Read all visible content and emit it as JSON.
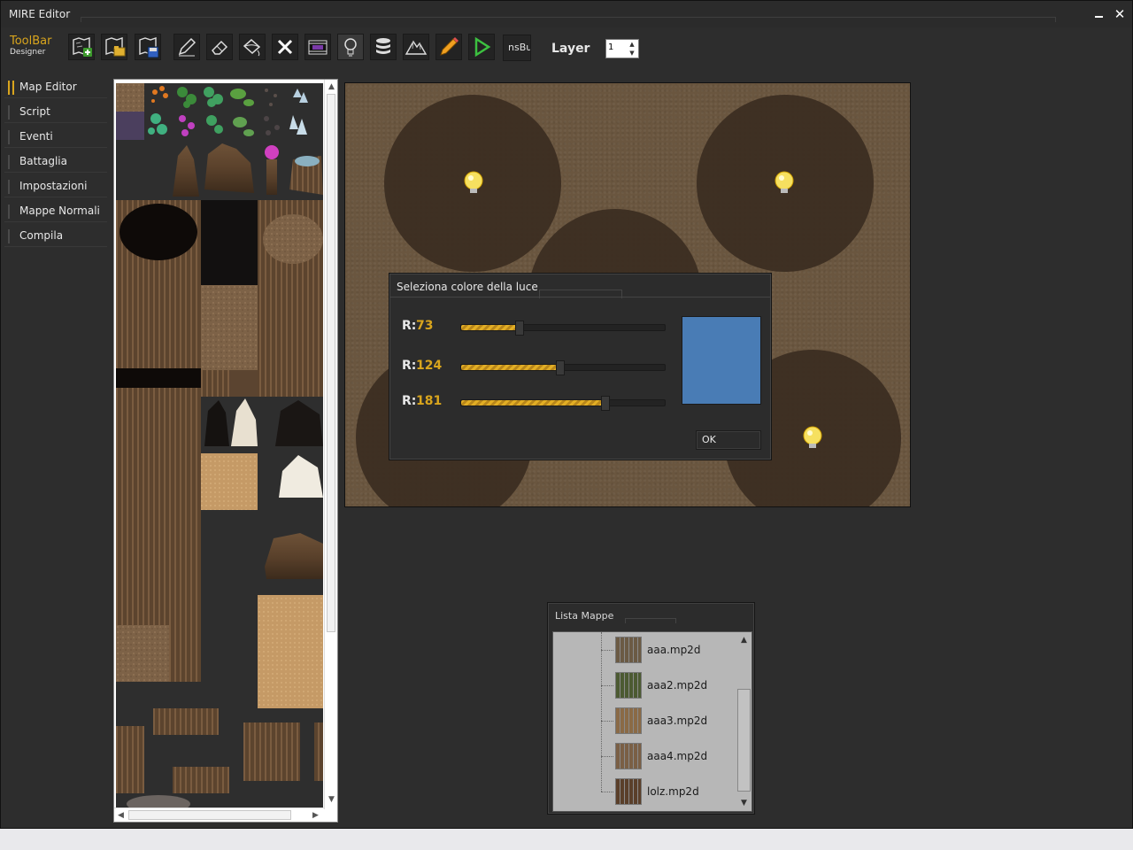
{
  "window": {
    "title": "MIRE Editor"
  },
  "toolbar": {
    "brand_main": "ToolBar",
    "brand_sub": "Designer",
    "tools": [
      "new-map-icon",
      "open-map-icon",
      "save-map-icon",
      "pencil-icon",
      "eraser-icon",
      "fill-bucket-icon",
      "delete-icon",
      "film-icon",
      "light-bulb-icon",
      "database-icon",
      "mountain-icon",
      "draw-icon",
      "play-icon"
    ],
    "nsbu_label": "nsBu",
    "layer_label": "Layer",
    "layer_value": "1"
  },
  "sidebar": {
    "items": [
      {
        "label": "Map Editor",
        "active": true
      },
      {
        "label": "Script"
      },
      {
        "label": "Eventi"
      },
      {
        "label": "Battaglia"
      },
      {
        "label": "Impostazioni"
      },
      {
        "label": "Mappe Normali"
      },
      {
        "label": "Compila"
      }
    ]
  },
  "dialog": {
    "title": "Seleziona colore della luce",
    "channels": [
      {
        "label": "R:",
        "value": 73,
        "max": 255
      },
      {
        "label": "R:",
        "value": 124,
        "max": 255
      },
      {
        "label": "R:",
        "value": 181,
        "max": 255
      }
    ],
    "preview_color": "#497cb5",
    "ok_label": "OK"
  },
  "maplist": {
    "title": "Lista Mappe",
    "items": [
      {
        "name": "aaa.mp2d",
        "color": "#6b5a44"
      },
      {
        "name": "aaa2.mp2d",
        "color": "#4c5a32"
      },
      {
        "name": "aaa3.mp2d",
        "color": "#8a6a46"
      },
      {
        "name": "aaa4.mp2d",
        "color": "#7a5f45"
      },
      {
        "name": "lolz.mp2d",
        "color": "#5a3f2a"
      }
    ]
  },
  "colors": {
    "accent": "#d9a51d",
    "background": "#2d2d2d"
  }
}
